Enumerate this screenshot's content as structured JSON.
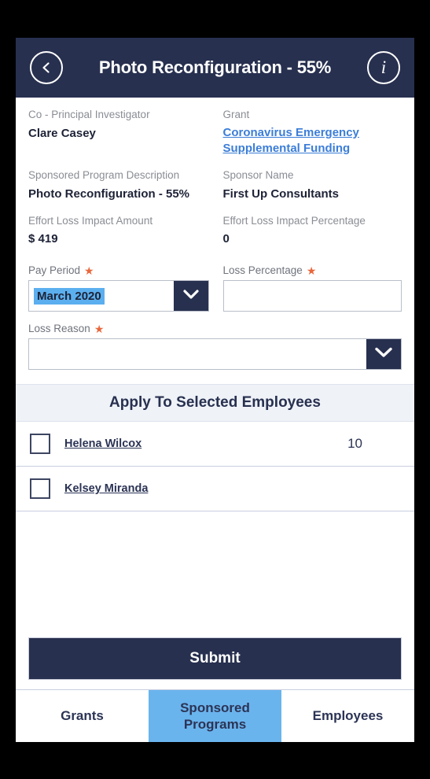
{
  "header": {
    "title": "Photo Reconfiguration - 55%",
    "back_icon": "chevron-left-icon",
    "info_icon": "info-icon",
    "info_glyph": "i"
  },
  "details": [
    {
      "label": "Co - Principal Investigator",
      "value": "Clare Casey",
      "right_label": "Grant",
      "right_value": "Coronavirus Emergency Supplemental Funding",
      "right_is_link": true
    },
    {
      "label": "Sponsored Program Description",
      "value": "Photo Reconfiguration - 55%",
      "right_label": "Sponsor Name",
      "right_value": "First Up Consultants",
      "right_is_link": false
    },
    {
      "label": "Effort Loss Impact Amount",
      "value": "$ 419",
      "right_label": "Effort Loss Impact Percentage",
      "right_value": "0",
      "right_is_link": false
    }
  ],
  "form": {
    "pay_period": {
      "label": "Pay Period",
      "required_marker": "★",
      "value": "March 2020",
      "selected": true
    },
    "loss_percentage": {
      "label": "Loss Percentage",
      "required_marker": "★",
      "value": "",
      "placeholder": ""
    },
    "loss_reason": {
      "label": "Loss Reason",
      "required_marker": "★",
      "value": "",
      "placeholder": ""
    }
  },
  "employees": {
    "section_title": "Apply To Selected Employees",
    "rows": [
      {
        "name": "Helena Wilcox",
        "value": "10",
        "checked": false
      },
      {
        "name": "Kelsey Miranda",
        "value": "",
        "checked": false
      }
    ]
  },
  "submit": {
    "label": "Submit"
  },
  "tabs": [
    {
      "label": "Grants",
      "active": false
    },
    {
      "label": "Sponsored Programs",
      "active": true
    },
    {
      "label": "Employees",
      "active": false
    }
  ],
  "colors": {
    "navy": "#27304f",
    "accent_blue": "#6ab4ee",
    "selection_blue": "#5bafef",
    "link_blue": "#3b7dd8",
    "required_orange": "#e8673c",
    "section_bg": "#eff2f7"
  }
}
